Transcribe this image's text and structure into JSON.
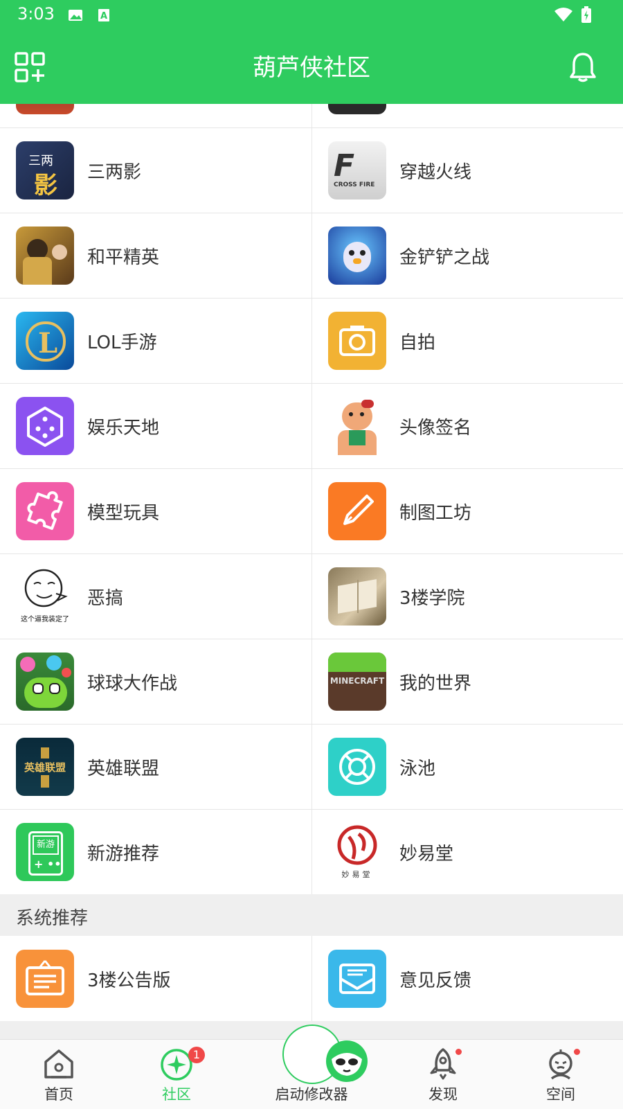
{
  "status_bar": {
    "time": "3:03"
  },
  "app": {
    "title": "葫芦侠社区"
  },
  "colors": {
    "brand": "#2ecc5f",
    "badge": "#f04848"
  },
  "categories": [
    {
      "left": {
        "label": "三两影",
        "icon": "sanliangying-icon"
      },
      "right": {
        "label": "穿越火线",
        "icon": "crossfire-icon"
      }
    },
    {
      "left": {
        "label": "和平精英",
        "icon": "heping-jingying-icon"
      },
      "right": {
        "label": "金铲铲之战",
        "icon": "jinchanchan-icon"
      }
    },
    {
      "left": {
        "label": "LOL手游",
        "icon": "lol-icon"
      },
      "right": {
        "label": "自拍",
        "icon": "camera-icon"
      }
    },
    {
      "left": {
        "label": "娱乐天地",
        "icon": "dice-icon"
      },
      "right": {
        "label": "头像签名",
        "icon": "avatar-cartoon-icon"
      }
    },
    {
      "left": {
        "label": "模型玩具",
        "icon": "puzzle-icon"
      },
      "right": {
        "label": "制图工坊",
        "icon": "pen-icon"
      }
    },
    {
      "left": {
        "label": "恶搞",
        "icon": "meme-face-icon"
      },
      "right": {
        "label": "3楼学院",
        "icon": "book-icon"
      }
    },
    {
      "left": {
        "label": "球球大作战",
        "icon": "ball-battle-icon"
      },
      "right": {
        "label": "我的世界",
        "icon": "minecraft-icon"
      }
    },
    {
      "left": {
        "label": "英雄联盟",
        "icon": "lol-pc-icon"
      },
      "right": {
        "label": "泳池",
        "icon": "lifebuoy-icon"
      }
    },
    {
      "left": {
        "label": "新游推荐",
        "icon": "new-game-icon"
      },
      "right": {
        "label": "妙易堂",
        "icon": "miaoyitang-icon"
      }
    }
  ],
  "meme_caption": "这个逼我装定了",
  "newgame_icon_text": "新游",
  "miaoyitang_caption": "妙易堂",
  "minecraft_text": "MINECRAFT",
  "crossfire_text": "CROSS FIRE",
  "lolpc_text": "英雄联盟",
  "sanliang_text_1": "三两",
  "sanliang_text_2": "影",
  "system_section": {
    "title": "系统推荐",
    "items": [
      {
        "label": "3楼公告版",
        "icon": "notice-board-icon"
      },
      {
        "label": "意见反馈",
        "icon": "feedback-mail-icon"
      }
    ]
  },
  "bottom_nav": {
    "home": "首页",
    "community": "社区",
    "community_badge": "1",
    "launcher": "启动修改器",
    "discover": "发现",
    "space": "空间",
    "active": "社区"
  }
}
